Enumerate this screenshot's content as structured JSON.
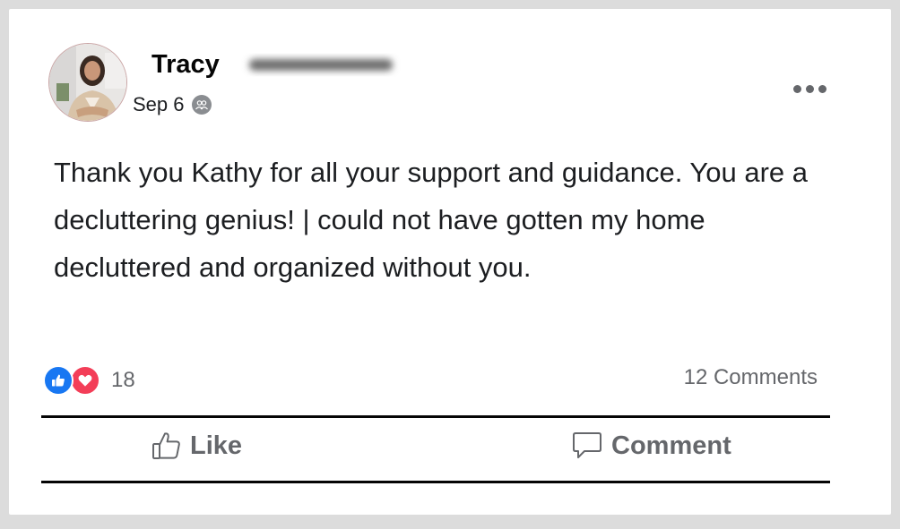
{
  "post": {
    "author": "Tracy",
    "date": "Sep 6",
    "body": "Thank you Kathy for all your support and guidance. You are a decluttering genius! | could not have gotten my home decluttered and organized without you.",
    "privacy_icon": "friends-icon",
    "more_icon": "more-dots-icon"
  },
  "reactions": {
    "types": [
      "like",
      "love"
    ],
    "count": "18",
    "colors": {
      "like": "#1877f2",
      "love": "#f33e58"
    }
  },
  "comments": {
    "label": "12 Comments"
  },
  "actions": {
    "like_label": "Like",
    "comment_label": "Comment"
  },
  "colors": {
    "text": "#1c1e21",
    "muted": "#65676b",
    "background": "#dcdcdc",
    "card": "#ffffff"
  }
}
